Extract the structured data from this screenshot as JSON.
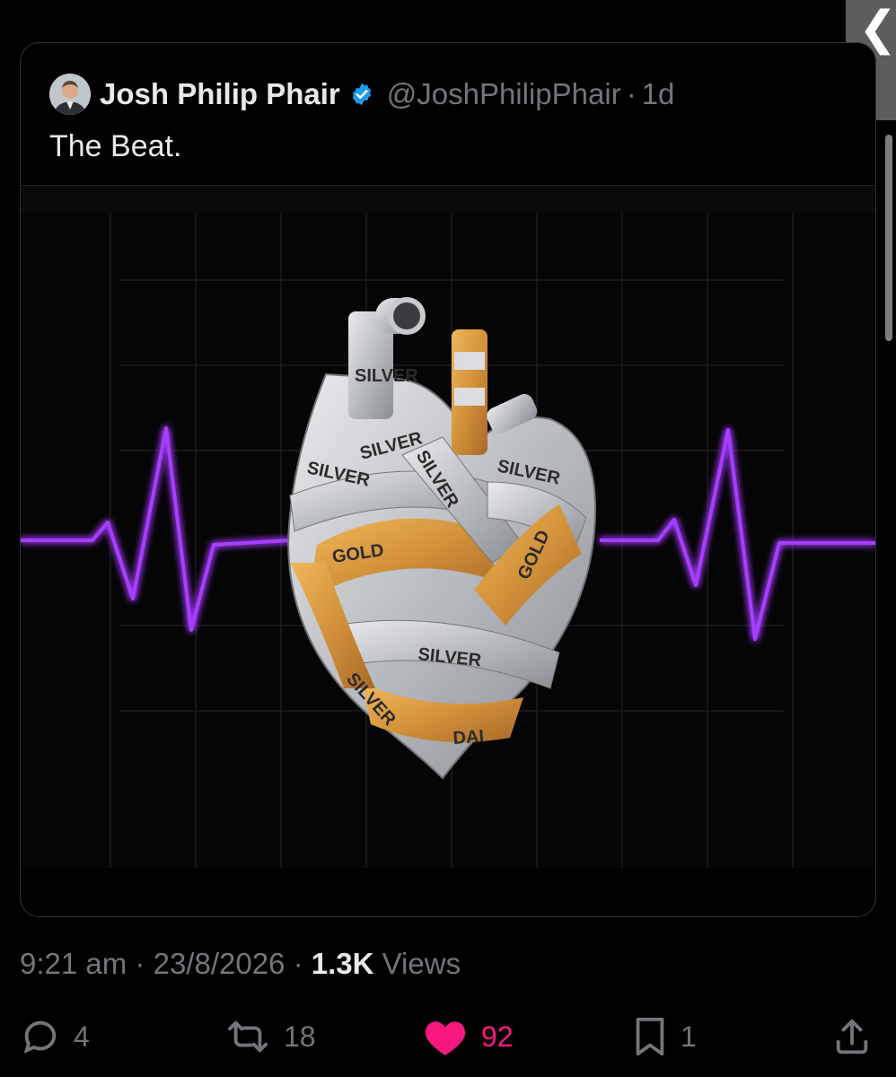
{
  "quoted_post": {
    "author_name": "Josh Philip Phair",
    "handle": "@JoshPhilipPhair",
    "separator": "·",
    "time_ago": "1d",
    "text": "The Beat.",
    "media": {
      "labels": [
        "SILVER",
        "SILVER",
        "SILVER",
        "SILVER",
        "SILVER",
        "GOLD",
        "GOLD",
        "SILVER",
        "SILVER",
        "DAI"
      ],
      "pulse_color": "#a63dff",
      "gold_color": "#d99a3b",
      "silver_color": "#c7c9cc"
    }
  },
  "post_meta": {
    "time": "9:21 am",
    "date": "23/8/2026",
    "sep": "·",
    "views_count": "1.3K",
    "views_label": "Views"
  },
  "actions": {
    "replies": "4",
    "reposts": "18",
    "likes": "92",
    "bookmarks": "1"
  },
  "colors": {
    "like": "#f91880",
    "verified": "#1d9bf0",
    "muted": "#71767b"
  },
  "scroll_tab_glyph": "❮"
}
